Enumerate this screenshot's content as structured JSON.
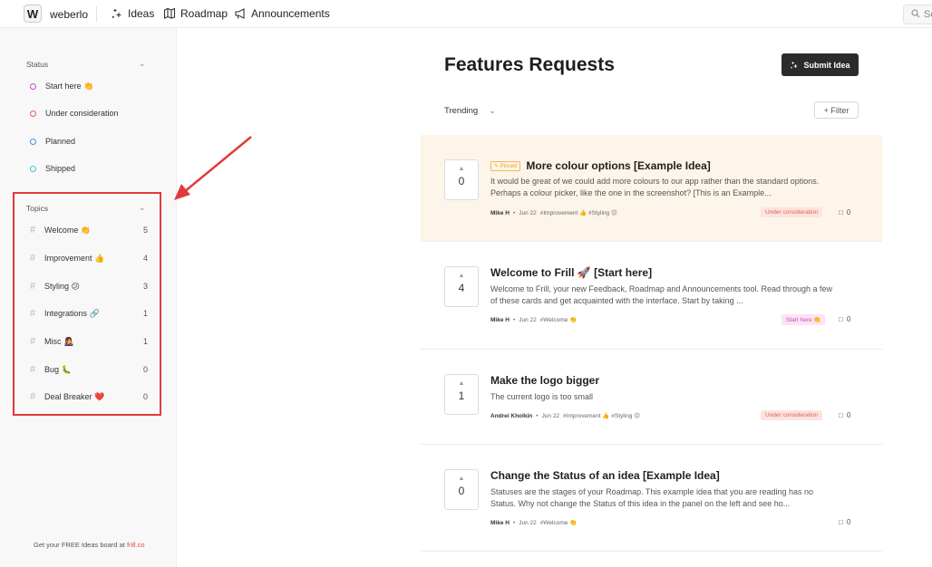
{
  "topbar": {
    "logo_letter": "W",
    "brand": "weberlo",
    "nav": [
      {
        "label": "Ideas",
        "icon": "sparkle-icon"
      },
      {
        "label": "Roadmap",
        "icon": "map-icon"
      },
      {
        "label": "Announcements",
        "icon": "megaphone-icon"
      }
    ],
    "search_placeholder": "Se"
  },
  "sidebar": {
    "status_title": "Status",
    "statuses": [
      {
        "label": "Start here 👏",
        "color": "#c64fd0"
      },
      {
        "label": "Under consideration",
        "color": "#e5604f"
      },
      {
        "label": "Planned",
        "color": "#4a8fd8"
      },
      {
        "label": "Shipped",
        "color": "#3ec5d8"
      }
    ],
    "topics_title": "Topics",
    "topics": [
      {
        "label": "Welcome 👏",
        "count": "5"
      },
      {
        "label": "Improvement 👍",
        "count": "4"
      },
      {
        "label": "Styling 😕",
        "count": "3"
      },
      {
        "label": "Integrations 🔗",
        "count": "1"
      },
      {
        "label": "Misc 👩‍🎤",
        "count": "1"
      },
      {
        "label": "Bug 🐛",
        "count": "0"
      },
      {
        "label": "Deal Breaker ❤️",
        "count": "0"
      }
    ],
    "footer_text": "Get your FREE Ideas board at ",
    "footer_link": "frill.co"
  },
  "main": {
    "title": "Features Requests",
    "submit_label": "Submit Idea",
    "sort_label": "Trending",
    "filter_label": "+ Filter"
  },
  "ideas": [
    {
      "votes": "0",
      "pinned_label": "✎ Pinned",
      "title": "More colour options [Example Idea]",
      "desc": "It would be great of we could add more colours to our app rather than the standard options. Perhaps a colour picker, like the one in the screenshot? [This is an Example...",
      "author": "Mike H",
      "date": "Jun 22",
      "tags": "#Improvement 👍  #Styling 😕",
      "status": "Under consideration",
      "comments": "0"
    },
    {
      "votes": "4",
      "title": "Welcome to Frill 🚀 [Start here]",
      "desc": "Welcome to Frill, your new Feedback, Roadmap and Announcements tool. Read through a few of these cards and get acquainted with the interface. Start by taking ...",
      "author": "Mike H",
      "date": "Jun 22",
      "tags": "#Welcome 👏",
      "status": "Start here 👏",
      "comments": "0"
    },
    {
      "votes": "1",
      "title": "Make the logo bigger",
      "desc": "The current logo is too small",
      "author": "Andrei Kholkin",
      "date": "Jun 22",
      "tags": "#Improvement 👍  #Styling 😕",
      "status": "Under consideration",
      "comments": "0"
    },
    {
      "votes": "0",
      "title": "Change the Status of an idea [Example Idea]",
      "desc": "Statuses are the stages of your Roadmap. This example idea that you are reading has no Status. Why not change the Status of this idea in the panel on the left and see ho...",
      "author": "Mike H",
      "date": "Jun 22",
      "tags": "#Welcome 👏",
      "comments": "0"
    }
  ],
  "annotation_color": "#e23b3b"
}
